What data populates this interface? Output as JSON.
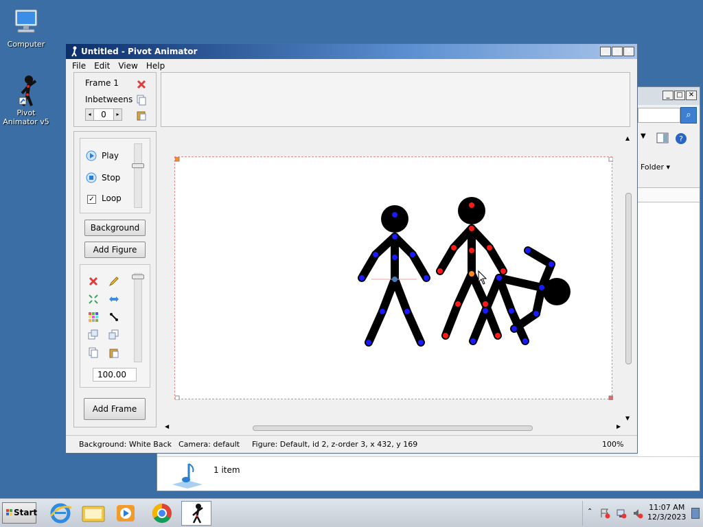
{
  "desktop": {
    "icons": [
      {
        "label": "Computer"
      },
      {
        "label": "Pivot Animator v5"
      }
    ]
  },
  "background_window": {
    "search_icon": "search-icon",
    "view_menu_label": "Folder",
    "status_text": "1 item"
  },
  "window": {
    "title": "Untitled - Pivot Animator",
    "menu": [
      "File",
      "Edit",
      "View",
      "Help"
    ]
  },
  "frame_panel": {
    "frame_label": "Frame 1",
    "inbetweens_label": "Inbetweens",
    "inbetweens_value": "0"
  },
  "playback": {
    "play_label": "Play",
    "stop_label": "Stop",
    "loop_label": "Loop",
    "loop_checked": true
  },
  "buttons": {
    "background": "Background",
    "add_figure": "Add Figure",
    "add_frame": "Add Frame"
  },
  "figure_tools": {
    "scale_value": "100.00"
  },
  "status": {
    "background": "Background: White Back",
    "camera": "Camera: default",
    "figure": "Figure: Default,  id 2,  z-order 3,  x 432, y 169",
    "zoom": "100%"
  },
  "taskbar": {
    "start_label": "Start",
    "apps": [
      "Internet Explorer",
      "Windows Explorer",
      "Windows Media Player",
      "Google Chrome",
      "Pivot Animator"
    ],
    "time": "11:07 AM",
    "date": "12/3/2023"
  },
  "colors": {
    "desktop": "#3a6ea5",
    "joint_blue": "#1a1aff",
    "joint_red": "#ff1a1a",
    "joint_orange": "#ff8c1a",
    "stage_border": "#e08a8a"
  }
}
